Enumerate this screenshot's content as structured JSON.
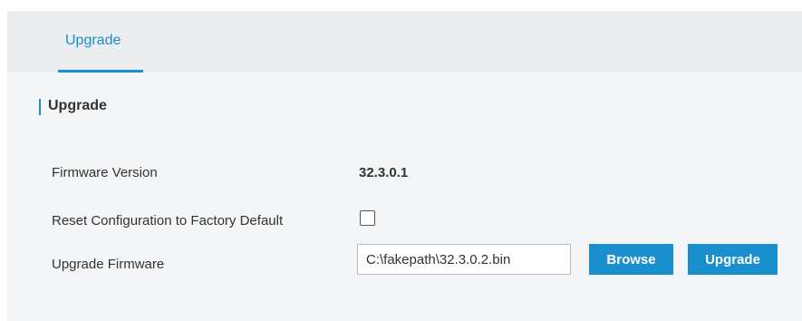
{
  "tabs": [
    {
      "label": "Upgrade",
      "active": true
    }
  ],
  "section": {
    "title": "Upgrade"
  },
  "rows": {
    "firmware_version": {
      "label": "Firmware Version",
      "value": "32.3.0.1"
    },
    "reset_config": {
      "label": "Reset Configuration to Factory Default",
      "checked": false
    },
    "upgrade_firmware": {
      "label": "Upgrade Firmware",
      "file_value": "C:\\fakepath\\32.3.0.2.bin"
    }
  },
  "buttons": {
    "browse_label": "Browse",
    "upgrade_label": "Upgrade"
  },
  "colors": {
    "accent": "#1a8fce",
    "panel_bg": "#f4f5f6",
    "tabbar_bg": "#ebedee",
    "text": "#333333"
  }
}
